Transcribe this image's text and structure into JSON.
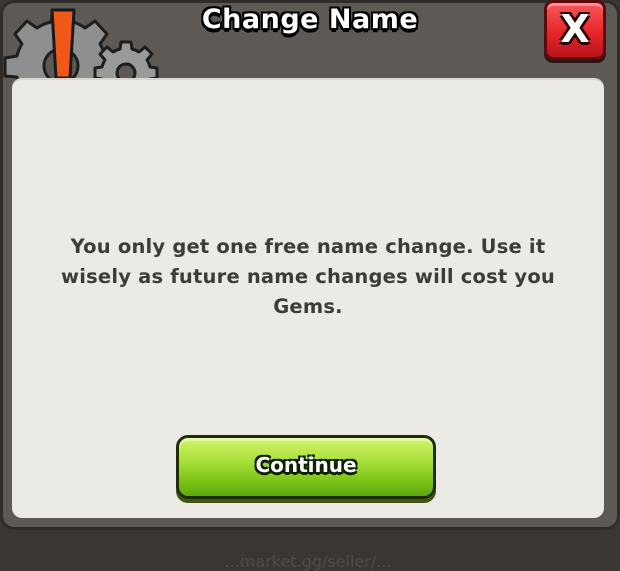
{
  "dialog": {
    "title": "Change Name",
    "close_label": "X",
    "message": "You only get one free name change. Use it wisely as future name changes will cost you Gems.",
    "continue_label": "Continue",
    "watermark": "...market.gg/seller/..."
  },
  "colors": {
    "close_button": "#e6262b",
    "continue_button": "#7cc316",
    "panel_background": "#ebeae4",
    "frame": "#5d5955",
    "alert_mark": "#f2571a"
  },
  "icons": {
    "settings_alert": "gear-alert-icon",
    "close": "close-icon"
  }
}
